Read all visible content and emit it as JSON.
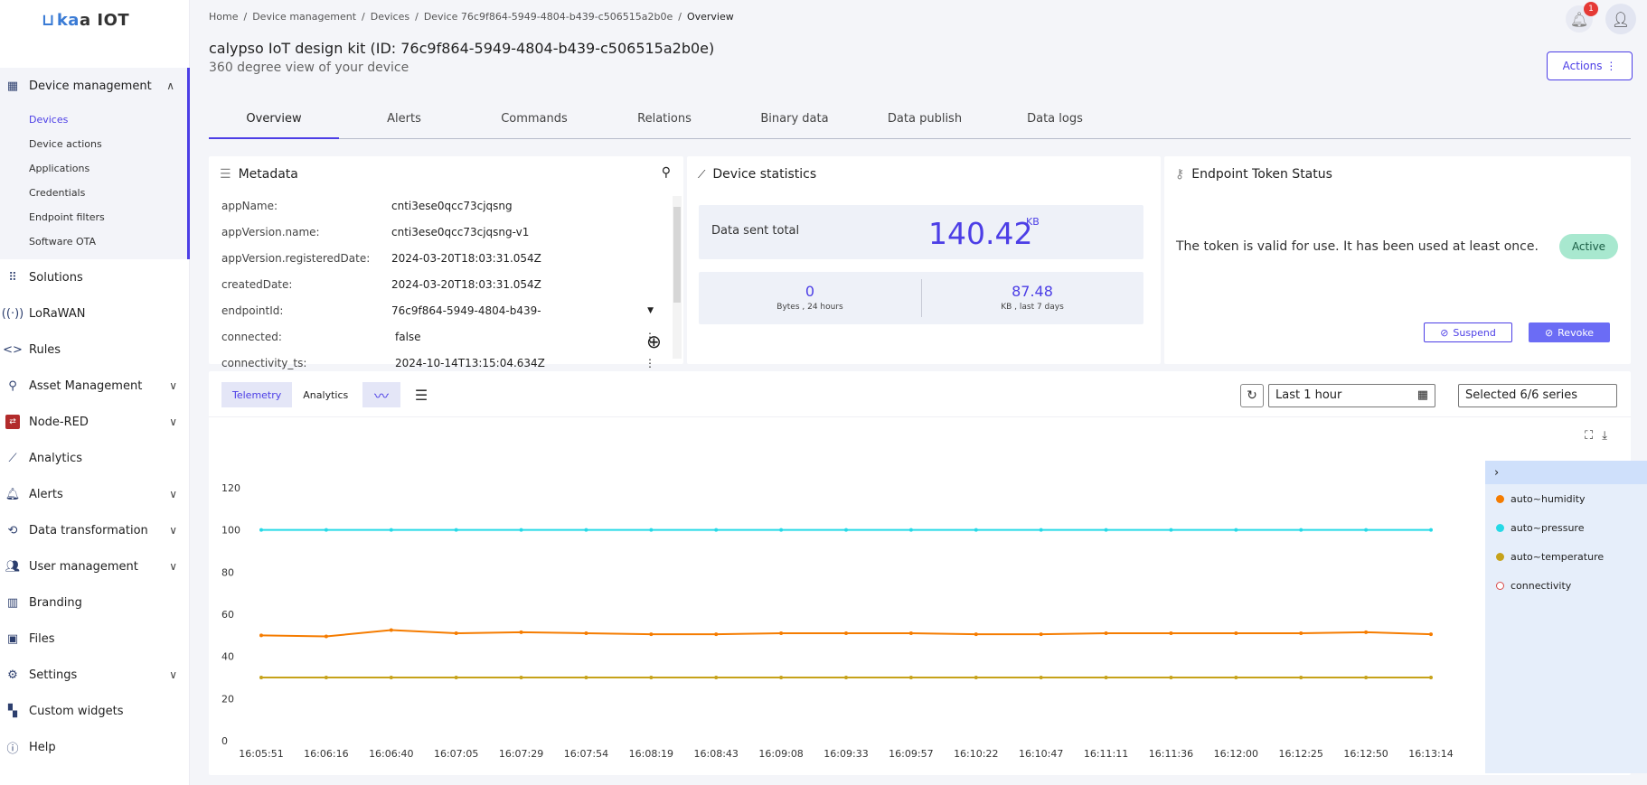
{
  "app": {
    "logo_pre": "",
    "logo_k": "ka",
    "logo_post": "a IOT"
  },
  "sidebar": {
    "items": [
      {
        "label": "Device management",
        "icon": "device-management-icon"
      },
      {
        "label": "Solutions",
        "icon": "solutions-icon"
      },
      {
        "label": "LoRaWAN",
        "icon": "lorawan-icon"
      },
      {
        "label": "Rules",
        "icon": "rules-icon"
      },
      {
        "label": "Asset Management",
        "icon": "asset-management-icon"
      },
      {
        "label": "Node-RED",
        "icon": "node-red-icon"
      },
      {
        "label": "Analytics",
        "icon": "analytics-icon"
      },
      {
        "label": "Alerts",
        "icon": "alerts-icon"
      },
      {
        "label": "Data transformation",
        "icon": "data-transformation-icon"
      },
      {
        "label": "User management",
        "icon": "user-management-icon"
      },
      {
        "label": "Branding",
        "icon": "branding-icon"
      },
      {
        "label": "Files",
        "icon": "files-icon"
      },
      {
        "label": "Settings",
        "icon": "settings-icon"
      },
      {
        "label": "Custom widgets",
        "icon": "custom-widgets-icon"
      },
      {
        "label": "Help",
        "icon": "help-icon"
      }
    ],
    "sub_items": [
      "Devices",
      "Device actions",
      "Applications",
      "Credentials",
      "Endpoint filters",
      "Software OTA"
    ]
  },
  "breadcrumb": {
    "home": "Home",
    "device_management": "Device management",
    "devices": "Devices",
    "device": "Device 76c9f864-5949-4804-b439-c506515a2b0e",
    "current": "Overview",
    "sep": "/"
  },
  "header": {
    "title": "calypso IoT design kit (ID: 76c9f864-5949-4804-b439-c506515a2b0e)",
    "subtitle": "360 degree view of your device",
    "actions": "Actions ⋮",
    "notifications": "1"
  },
  "tabs": [
    "Overview",
    "Alerts",
    "Commands",
    "Relations",
    "Binary data",
    "Data publish",
    "Data logs"
  ],
  "metadata": {
    "title": "Metadata",
    "rows": [
      {
        "key": "appName:",
        "value": "cnti3ese0qcc73cjqsng"
      },
      {
        "key": "appVersion.name:",
        "value": "cnti3ese0qcc73cjqsng-v1"
      },
      {
        "key": "appVersion.registeredDate:",
        "value": "2024-03-20T18:03:31.054Z"
      },
      {
        "key": "createdDate:",
        "value": "2024-03-20T18:03:31.054Z"
      },
      {
        "key": "endpointId:",
        "value": "76c9f864-5949-4804-b439-"
      },
      {
        "key": "connected:",
        "value": "false"
      },
      {
        "key": "connectivity_ts:",
        "value": "2024-10-14T13:15:04.634Z"
      }
    ]
  },
  "stats": {
    "title": "Device statistics",
    "sent_label": "Data sent total",
    "sent_value": "140.42",
    "sent_unit": "KB",
    "day_value": "0",
    "day_label": "Bytes , 24 hours",
    "week_value": "87.48",
    "week_label": "KB , last 7 days"
  },
  "token": {
    "title": "Endpoint Token Status",
    "message": "The token is valid for use. It has been used at least once.",
    "status": "Active",
    "suspend": "Suspend",
    "revoke": "Revoke"
  },
  "chart_controls": {
    "telemetry": "Telemetry",
    "analytics": "Analytics",
    "range": "Last 1 hour",
    "series": "Selected 6/6 series"
  },
  "colors": {
    "accent": "#4c3ee6",
    "humidity": "#f57c00",
    "pressure": "#26d9e6",
    "temperature": "#c6a21a",
    "connectivity": "#d84b4b"
  },
  "chart_data": {
    "type": "line",
    "x": [
      "16:05:51",
      "16:06:16",
      "16:06:40",
      "16:07:05",
      "16:07:29",
      "16:07:54",
      "16:08:19",
      "16:08:43",
      "16:09:08",
      "16:09:33",
      "16:09:57",
      "16:10:22",
      "16:10:47",
      "16:11:11",
      "16:11:36",
      "16:12:00",
      "16:12:25",
      "16:12:50",
      "16:13:14"
    ],
    "ylim": [
      0,
      120
    ],
    "yticks": [
      0,
      20,
      40,
      60,
      80,
      100,
      120
    ],
    "series": [
      {
        "name": "auto~humidity",
        "color": "#f57c00",
        "values": [
          50,
          49.5,
          52.5,
          51,
          51.5,
          51,
          50.5,
          50.5,
          51,
          51,
          51,
          50.5,
          50.5,
          51,
          51,
          51,
          51,
          51.5,
          50.5
        ]
      },
      {
        "name": "auto~pressure",
        "color": "#26d9e6",
        "values": [
          100,
          100,
          100,
          100,
          100,
          100,
          100,
          100,
          100,
          100,
          100,
          100,
          100,
          100,
          100,
          100,
          100,
          100,
          100
        ]
      },
      {
        "name": "auto~temperature",
        "color": "#c6a21a",
        "values": [
          30,
          30,
          30,
          30,
          30,
          30,
          30,
          30,
          30,
          30,
          30,
          30,
          30,
          30,
          30,
          30,
          30,
          30,
          30
        ]
      },
      {
        "name": "connectivity",
        "color": "#d84b4b",
        "values": []
      }
    ]
  }
}
